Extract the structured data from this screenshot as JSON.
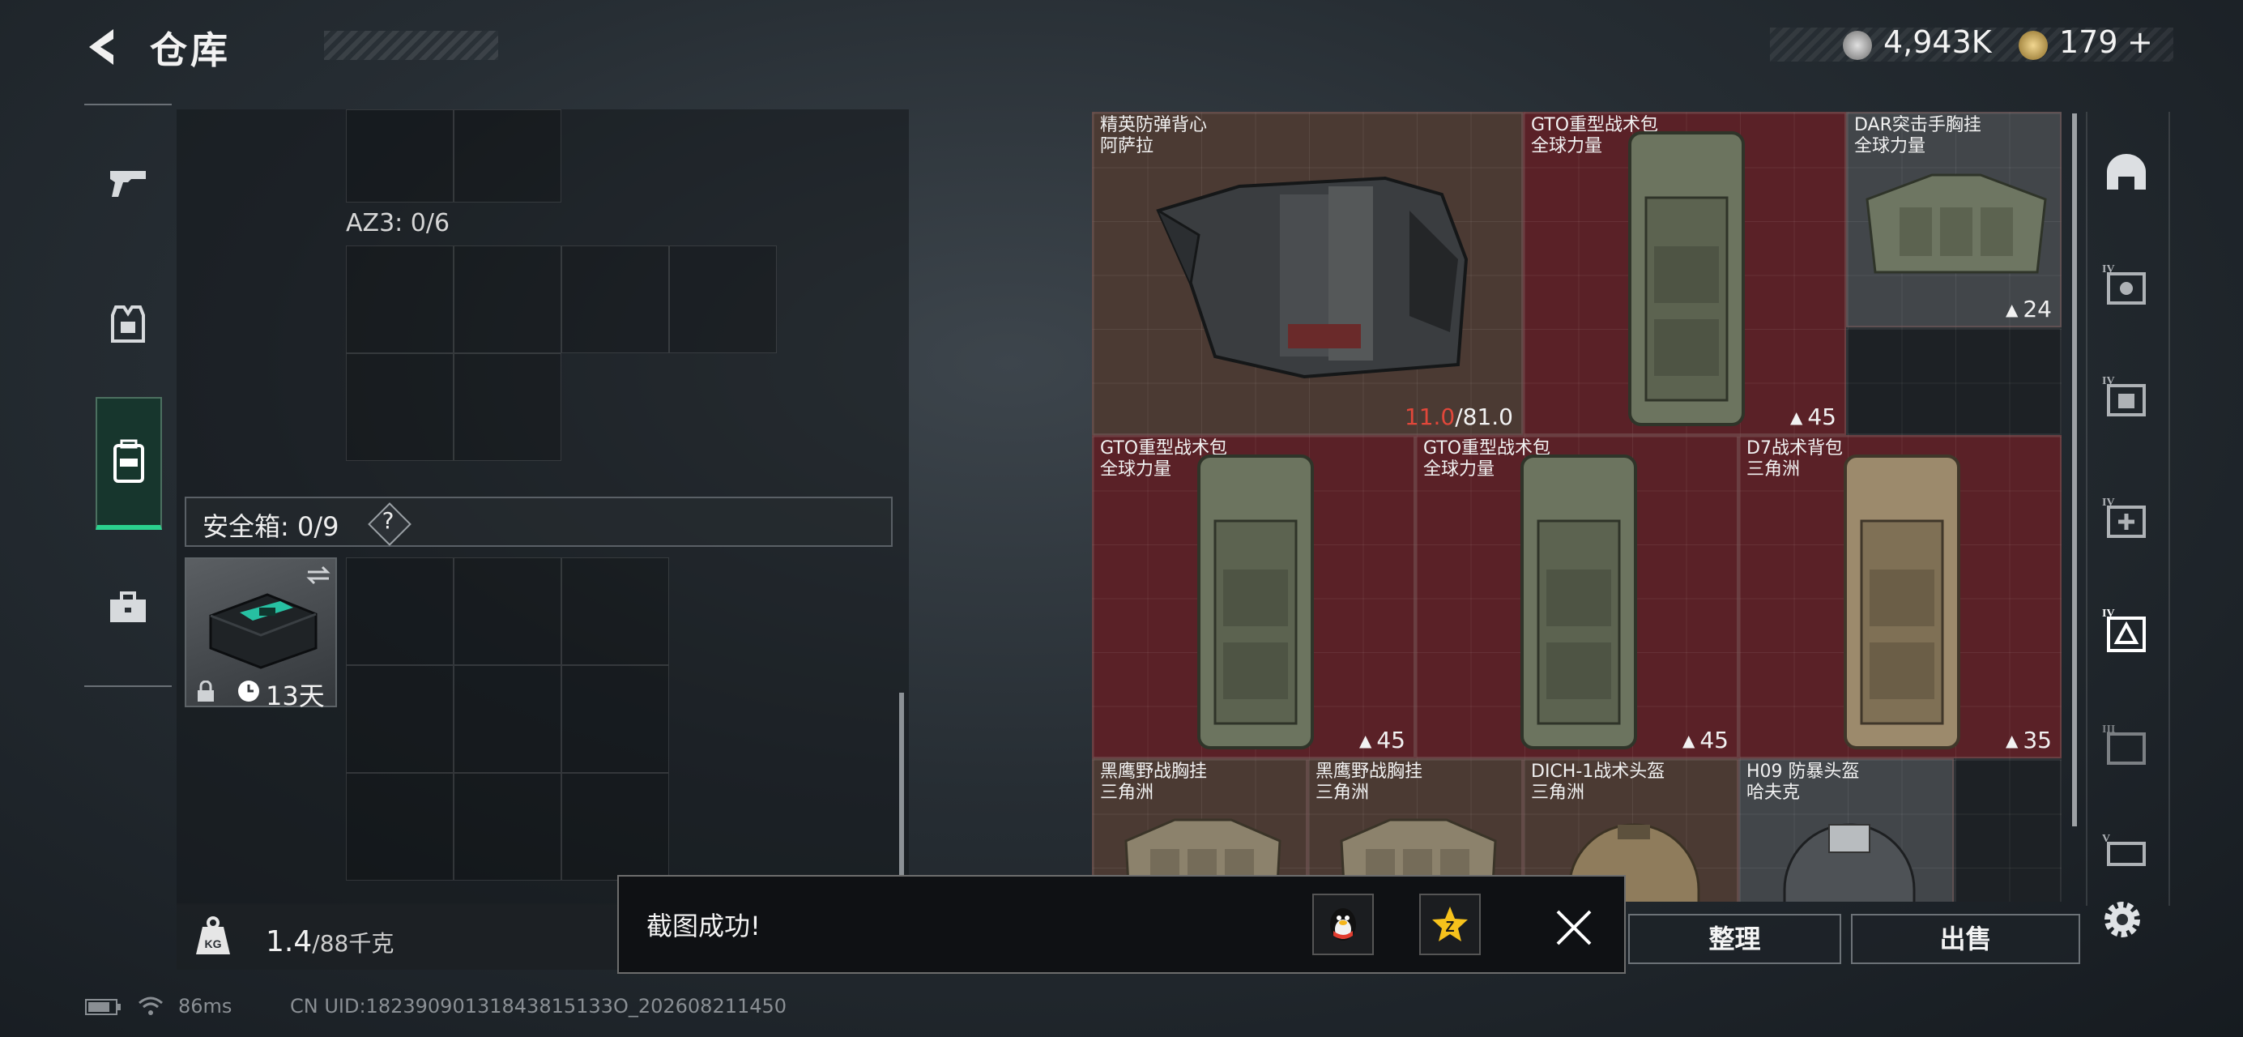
{
  "header": {
    "title": "仓库",
    "currency1": "4,943K",
    "currency2": "179",
    "add_symbol": "+"
  },
  "left_panel": {
    "az3_label": "AZ3: 0/6",
    "safebox_label": "安全箱: 0/9",
    "help": "?",
    "safebox_item_duration": "13天",
    "weight_value": "1.4",
    "weight_max": "/88千克"
  },
  "inventory": {
    "items": [
      {
        "name": "精英防弹背心",
        "origin": "阿萨拉",
        "durability_current": "11.0",
        "durability_max": "/81.0",
        "color": "#4b3a33"
      },
      {
        "name": "GTO重型战术包",
        "origin": "全球力量",
        "count": "45",
        "color": "#5a2127"
      },
      {
        "name": "DAR突击手胸挂",
        "origin": "全球力量",
        "count": "24",
        "color": "#42464a"
      },
      {
        "name": "GTO重型战术包",
        "origin": "全球力量",
        "count": "45",
        "color": "#5a2127"
      },
      {
        "name": "GTO重型战术包",
        "origin": "全球力量",
        "count": "45",
        "color": "#5a2127"
      },
      {
        "name": "D7战术背包",
        "origin": "三角洲",
        "count": "35",
        "color": "#5a2127"
      },
      {
        "name": "黑鹰野战胸挂",
        "origin": "三角洲",
        "color": "#4b3a33"
      },
      {
        "name": "黑鹰野战胸挂",
        "origin": "三角洲",
        "color": "#4b3a33"
      },
      {
        "name": "DICH-1战术头盔",
        "origin": "三角洲",
        "color": "#4b3a33"
      },
      {
        "name": "H09 防暴头盔",
        "origin": "哈夫克",
        "color": "#42464a"
      }
    ]
  },
  "right_nav": {
    "items": [
      "helmet-slot",
      "IV",
      "IV",
      "IV",
      "IV",
      "III",
      "V"
    ]
  },
  "actions": {
    "sort_label": "整理",
    "sell_label": "出售"
  },
  "toast": {
    "message": "截图成功!"
  },
  "status_bar": {
    "ping": "86ms",
    "uid": "CN UID:18239090131843815133O_202608211450"
  }
}
